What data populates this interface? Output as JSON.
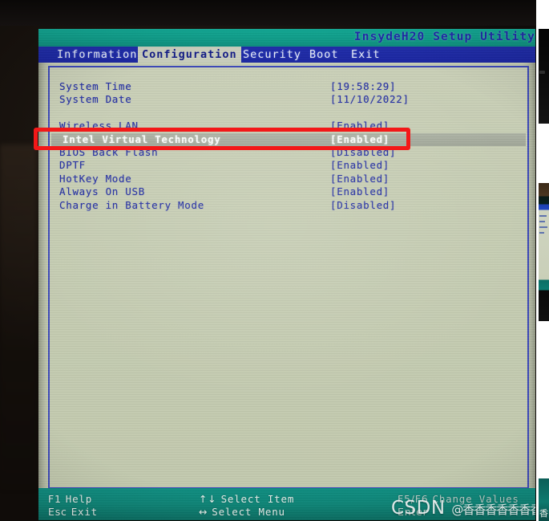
{
  "window": {
    "title": "InsydeH20 Setup Utility"
  },
  "menu": {
    "items": [
      {
        "label": "Information",
        "selected": false
      },
      {
        "label": "Configuration",
        "selected": true
      },
      {
        "label": "Security",
        "selected": false
      },
      {
        "label": "Boot",
        "selected": false
      },
      {
        "label": "Exit",
        "selected": false
      }
    ]
  },
  "settings": {
    "rows": [
      {
        "label": "System Time",
        "value": "[19:58:29]",
        "selected": false,
        "spacer": false
      },
      {
        "label": "System Date",
        "value": "[11/10/2022]",
        "selected": false,
        "spacer": false
      },
      {
        "label": "",
        "value": "",
        "selected": false,
        "spacer": true
      },
      {
        "label": "Wireless LAN",
        "value": "[Enabled]",
        "selected": false,
        "spacer": false
      },
      {
        "label": "Intel Virtual Technology",
        "value": "[Enabled]",
        "selected": true,
        "spacer": false
      },
      {
        "label": "BIOS Back Flash",
        "value": "[Disabled]",
        "selected": false,
        "spacer": false
      },
      {
        "label": "DPTF",
        "value": "[Enabled]",
        "selected": false,
        "spacer": false
      },
      {
        "label": "HotKey Mode",
        "value": "[Enabled]",
        "selected": false,
        "spacer": false
      },
      {
        "label": "Always On USB",
        "value": "[Enabled]",
        "selected": false,
        "spacer": false
      },
      {
        "label": "Charge in Battery Mode",
        "value": "[Disabled]",
        "selected": false,
        "spacer": false
      }
    ]
  },
  "footer": {
    "help_key": "F1",
    "help_label": "Help",
    "exit_key": "Esc",
    "exit_label": "Exit",
    "select_item_keys": "↑↓",
    "select_item_label": "Select Item",
    "select_menu_keys": "↔",
    "select_menu_label": "Select Menu",
    "change_values_keys": "F5/F6",
    "change_values_label": "Change Values",
    "enter_key": "Enter",
    "enter_label": ""
  },
  "watermark": {
    "brand": "CSDN",
    "handle": "@香香香香香香香"
  },
  "annotation": {
    "kind": "red-rectangle",
    "targets": "Intel Virtual Technology"
  },
  "colors": {
    "title_bar": "#0f9d8a",
    "menu_bar": "#1f2ca8",
    "panel_bg": "#c5ccb2",
    "panel_border": "#3a46b8",
    "text_blue": "#232ea0",
    "footer_bar": "#0e8476",
    "annotation_red": "#f31818"
  }
}
